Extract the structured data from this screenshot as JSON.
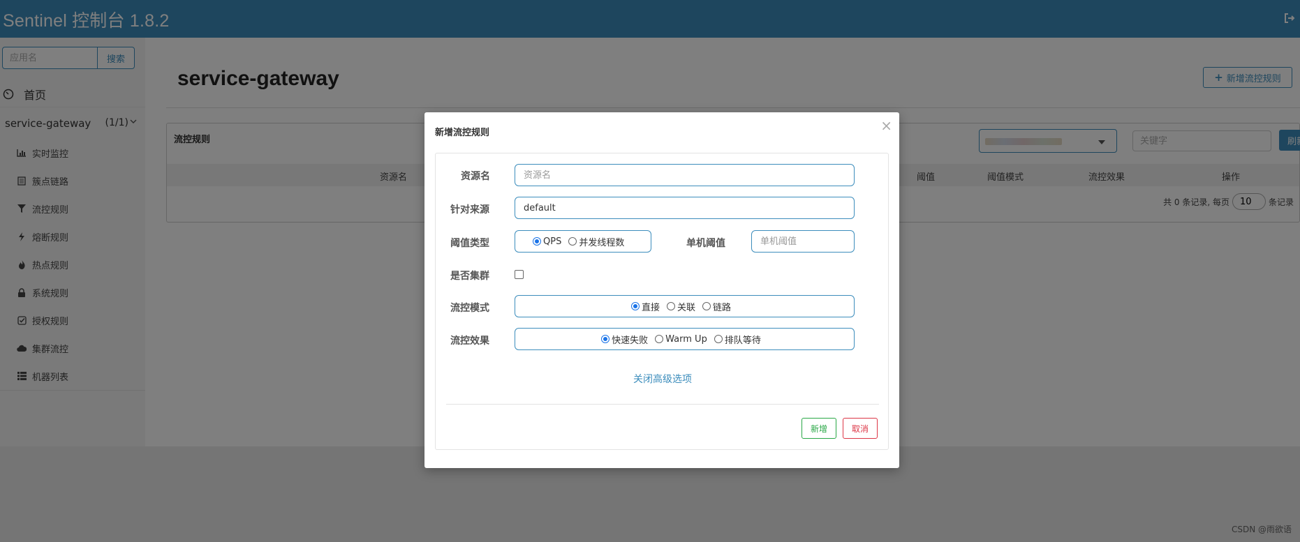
{
  "header": {
    "brand": "Sentinel 控制台 1.8.2",
    "logout_icon": "logout-icon"
  },
  "sidebar": {
    "search_placeholder": "应用名",
    "search_button": "搜索",
    "home": "首页",
    "app_name": "service-gateway",
    "app_count": "(1/1)",
    "items": [
      {
        "label": "实时监控",
        "icon": "bar-chart-icon"
      },
      {
        "label": "簇点链路",
        "icon": "list-icon"
      },
      {
        "label": "流控规则",
        "icon": "filter-icon"
      },
      {
        "label": "熔断规则",
        "icon": "flash-icon"
      },
      {
        "label": "热点规则",
        "icon": "fire-icon"
      },
      {
        "label": "系统规则",
        "icon": "lock-icon"
      },
      {
        "label": "授权规则",
        "icon": "check-icon"
      },
      {
        "label": "集群流控",
        "icon": "cloud-icon"
      },
      {
        "label": "机器列表",
        "icon": "th-list-icon"
      }
    ]
  },
  "main": {
    "title": "service-gateway",
    "add_rule_button": "新增流控规则",
    "panel": {
      "title": "流控规则",
      "keyword_placeholder": "关键字",
      "refresh_button": "刷新",
      "columns": [
        "资源名",
        "阈值",
        "阈值模式",
        "流控效果",
        "操作"
      ],
      "footer": {
        "prefix": "共 0 条记录, 每页",
        "page_size": "10",
        "suffix": "条记录"
      }
    }
  },
  "modal": {
    "title": "新增流控规则",
    "close": "×",
    "fields": {
      "resource_label": "资源名",
      "resource_placeholder": "资源名",
      "origin_label": "针对来源",
      "origin_value": "default",
      "threshold_type_label": "阈值类型",
      "threshold_type_options": [
        "QPS",
        "并发线程数"
      ],
      "threshold_type_selected": "QPS",
      "single_threshold_label": "单机阈值",
      "single_threshold_placeholder": "单机阈值",
      "cluster_label": "是否集群",
      "control_mode_label": "流控模式",
      "control_mode_options": [
        "直接",
        "关联",
        "链路"
      ],
      "control_mode_selected": "直接",
      "control_effect_label": "流控效果",
      "control_effect_options": [
        "快速失败",
        "Warm Up",
        "排队等待"
      ],
      "control_effect_selected": "快速失败"
    },
    "advanced_link": "关闭高级选项",
    "add_button": "新增",
    "cancel_button": "取消"
  },
  "watermark": "CSDN @雨欲语",
  "colors": {
    "primary": "#3c8dbc",
    "success": "#28a745",
    "danger": "#dc3545"
  }
}
